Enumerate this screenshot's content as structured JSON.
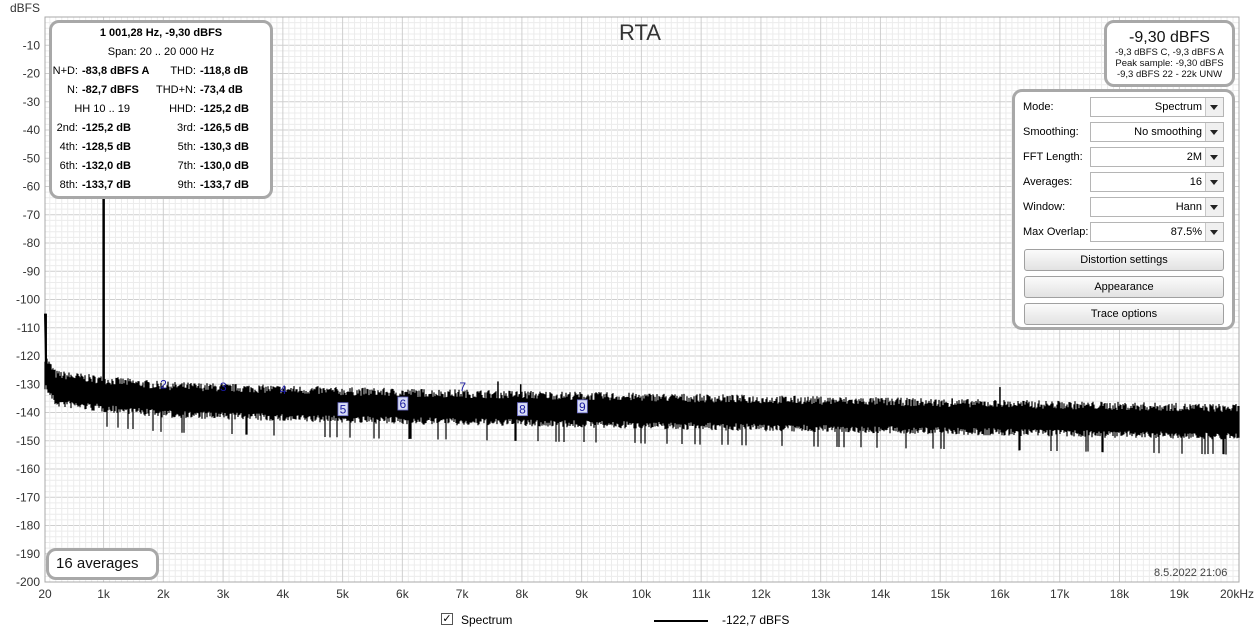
{
  "title": "RTA",
  "y_unit": "dBFS",
  "date": "8.5.2022 21:06",
  "averages_label": "16 averages",
  "distortion": {
    "header": "1 001,28 Hz, -9,30 dBFS",
    "span": "Span: 20 .. 20 000 Hz",
    "rows": [
      [
        {
          "label": "N+D:",
          "value": "-83,8 dBFS A"
        },
        {
          "label": "THD:",
          "value": "-118,8 dB"
        }
      ],
      [
        {
          "label": "N:",
          "value": "-82,7 dBFS"
        },
        {
          "label": "THD+N:",
          "value": "-73,4 dB"
        }
      ],
      [
        {
          "label": "HH 10 .. 19",
          "value": ""
        },
        {
          "label": "HHD:",
          "value": "-125,2 dB"
        }
      ],
      [
        {
          "label": "2nd:",
          "value": "-125,2 dB"
        },
        {
          "label": "3rd:",
          "value": "-126,5 dB"
        }
      ],
      [
        {
          "label": "4th:",
          "value": "-128,5 dB"
        },
        {
          "label": "5th:",
          "value": "-130,3 dB"
        }
      ],
      [
        {
          "label": "6th:",
          "value": "-132,0 dB"
        },
        {
          "label": "7th:",
          "value": "-130,0 dB"
        }
      ],
      [
        {
          "label": "8th:",
          "value": "-133,7 dB"
        },
        {
          "label": "9th:",
          "value": "-133,7 dB"
        }
      ]
    ]
  },
  "level": {
    "main": "-9,30 dBFS",
    "lines": [
      "-9,3 dBFS C, -9,3 dBFS A",
      "Peak sample: -9,30 dBFS",
      "-9,3 dBFS 22 - 22k UNW"
    ]
  },
  "settings": {
    "fields": [
      {
        "label": "Mode:",
        "value": "Spectrum"
      },
      {
        "label": "Smoothing:",
        "value": "No  smoothing"
      },
      {
        "label": "FFT Length:",
        "value": "2M"
      },
      {
        "label": "Averages:",
        "value": "16"
      },
      {
        "label": "Window:",
        "value": "Hann"
      },
      {
        "label": "Max Overlap:",
        "value": "87.5%"
      }
    ],
    "buttons": [
      "Distortion settings",
      "Appearance",
      "Trace options"
    ]
  },
  "legend": {
    "name": "Spectrum",
    "value": "-122,7 dBFS",
    "checked": true
  },
  "colors": {
    "trace": "#000000",
    "grid": "#d9d9d9",
    "harmonic_label": "#1a1aa0",
    "panel_border": "#a8a8a8"
  },
  "chart_data": {
    "type": "line",
    "x_unit": "Hz",
    "y_unit": "dBFS",
    "xlim": [
      20,
      20000
    ],
    "ylim": [
      -200,
      0
    ],
    "x_ticks": [
      {
        "value": 20,
        "label": "20"
      },
      {
        "value": 1000,
        "label": "1k"
      },
      {
        "value": 2000,
        "label": "2k"
      },
      {
        "value": 3000,
        "label": "3k"
      },
      {
        "value": 4000,
        "label": "4k"
      },
      {
        "value": 5000,
        "label": "5k"
      },
      {
        "value": 6000,
        "label": "6k"
      },
      {
        "value": 7000,
        "label": "7k"
      },
      {
        "value": 8000,
        "label": "8k"
      },
      {
        "value": 9000,
        "label": "9k"
      },
      {
        "value": 10000,
        "label": "10k"
      },
      {
        "value": 11000,
        "label": "11k"
      },
      {
        "value": 12000,
        "label": "12k"
      },
      {
        "value": 13000,
        "label": "13k"
      },
      {
        "value": 14000,
        "label": "14k"
      },
      {
        "value": 15000,
        "label": "15k"
      },
      {
        "value": 16000,
        "label": "16k"
      },
      {
        "value": 17000,
        "label": "17k"
      },
      {
        "value": 18000,
        "label": "18k"
      },
      {
        "value": 19000,
        "label": "19k"
      },
      {
        "value": 20000,
        "label": "20kHz"
      }
    ],
    "y_ticks": [
      -10,
      -20,
      -30,
      -40,
      -50,
      -60,
      -70,
      -80,
      -90,
      -100,
      -110,
      -120,
      -130,
      -140,
      -150,
      -160,
      -170,
      -180,
      -190,
      -200
    ],
    "grid": true,
    "series": [
      {
        "noise_floor": {
          "x": [
            20,
            200,
            1000,
            2000,
            5000,
            10000,
            15000,
            20000
          ],
          "y": [
            -125,
            -131,
            -133,
            -135,
            -137,
            -139,
            -141,
            -143
          ]
        },
        "noise_band_db": [
          -7,
          6
        ],
        "peaks": [
          {
            "x": 1001.28,
            "y": -9.3
          },
          {
            "x": 40,
            "y": -105
          },
          {
            "x": 7600,
            "y": -129
          },
          {
            "x": 7980,
            "y": -130
          },
          {
            "x": 10200,
            "y": -134
          },
          {
            "x": 15200,
            "y": -135
          },
          {
            "x": 16000,
            "y": -131
          }
        ]
      }
    ],
    "harmonic_markers": [
      {
        "label": "2",
        "x": 2002,
        "y": -130
      },
      {
        "label": "3",
        "x": 3004,
        "y": -131
      },
      {
        "label": "4",
        "x": 4005,
        "y": -132
      },
      {
        "label": "5",
        "x": 5006,
        "y": -139,
        "boxed": true
      },
      {
        "label": "6",
        "x": 6008,
        "y": -137,
        "boxed": true
      },
      {
        "label": "7",
        "x": 7009,
        "y": -131
      },
      {
        "label": "8",
        "x": 8010,
        "y": -139,
        "boxed": true
      },
      {
        "label": "9",
        "x": 9012,
        "y": -138,
        "boxed": true
      }
    ]
  }
}
